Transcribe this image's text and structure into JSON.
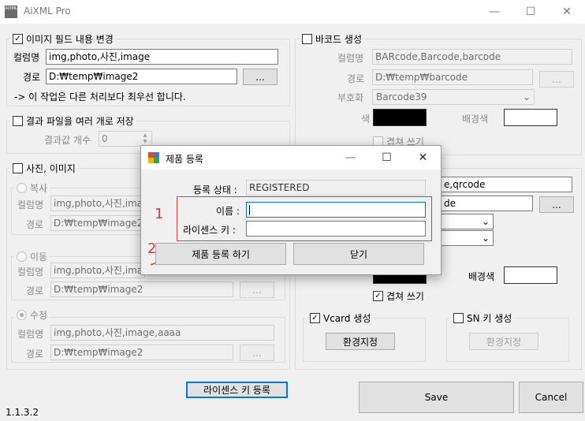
{
  "window": {
    "title": "AiXML Pro",
    "icon_text": "AiXML",
    "min": "—",
    "max": "☐",
    "close": "✕"
  },
  "image_field": {
    "checkbox_label": "이미지 필드 내용 변경",
    "checked": "✓",
    "colname_label": "컬럼명",
    "colname_value": "img,photo,사진,image",
    "path_label": "경로",
    "path_value": "D:₩temp₩image2",
    "browse": "...",
    "note": "-> 이 작업은 다른 처리보다 최우선 합니다."
  },
  "split_results": {
    "checkbox_label": "결과 파일을 여러 개로 저장",
    "count_label": "결과값 개수",
    "count_value": "0"
  },
  "photo_image": {
    "checkbox_label": "사진, 이미지",
    "copy": {
      "label": "복사",
      "colname_label": "컬럼명",
      "colname_value": "img,photo,사진,image",
      "path_label": "경로",
      "path_value": "D:₩temp₩image2"
    },
    "move": {
      "label": "이동",
      "colname_label": "컬럼명",
      "colname_value": "img,photo,사진,image",
      "path_label": "경로",
      "path_value": "D:₩temp₩image2",
      "browse": "..."
    },
    "modify": {
      "label": "수정",
      "colname_label": "컬럼명",
      "colname_value": "img,photo,사진,image,aaaa",
      "path_label": "경로",
      "path_value": "D:₩temp₩image2",
      "browse": "..."
    }
  },
  "barcode": {
    "checkbox_label": "바코드 생성",
    "colname_label": "컬럼명",
    "colname_value": "BARcode,Barcode,barcode",
    "path_label": "경로",
    "path_value": "D:₩temp₩barcode",
    "browse": "...",
    "encoding_label": "부호화",
    "encoding_value": "Barcode39",
    "color_label": "색",
    "color_value": "#000000",
    "bg_label": "배경색",
    "bg_value": "#ffffff",
    "overlay_label": "겹쳐 쓰기"
  },
  "qrcode": {
    "colname_partial": "e,qrcode",
    "path_partial": "de",
    "browse": "...",
    "bg_label": "배경색",
    "overlay_label": "겹쳐 쓰기",
    "overlay_checked": "✓",
    "color_value": "#000000",
    "bg_value": "#ffffff"
  },
  "vcard": {
    "checkbox_label": "Vcard 생성",
    "checked": "✓",
    "settings": "환경지정"
  },
  "sn_key": {
    "checkbox_label": "SN 키 생성",
    "settings": "환경지정"
  },
  "license_button": "라이센스 키 등록",
  "save_button": "Save",
  "cancel_button": "Cancel",
  "version": "1.1.3.2",
  "dialog": {
    "title": "제품 등록",
    "min": "—",
    "max": "☐",
    "close": "✕",
    "status_label": "등록 상태 :",
    "status_value": "REGISTERED",
    "name_label": "이름 :",
    "name_value": "",
    "key_label": "라이센스 키 :",
    "key_value": "",
    "register_button": "제품 등록 하기",
    "close_button": "닫기"
  },
  "annotations": {
    "num1": "1",
    "num2": "2",
    "color": "#e13b3b"
  }
}
